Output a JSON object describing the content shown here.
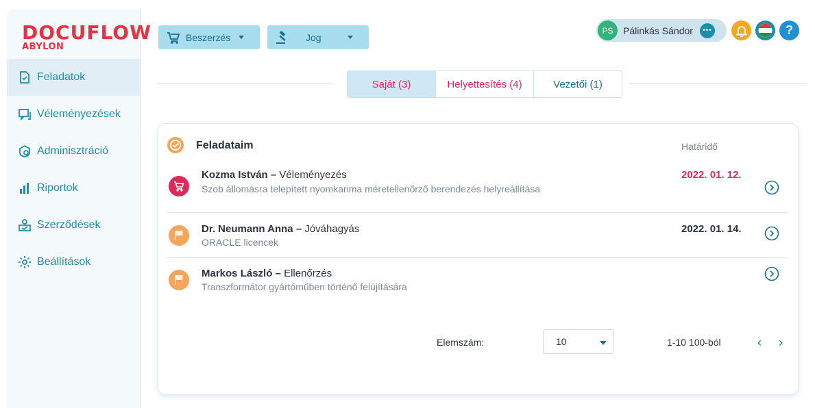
{
  "logo": {
    "main": "DOCUFLOW",
    "sub": "ABYLON"
  },
  "sidebar": {
    "items": [
      {
        "label": "Feladatok",
        "icon": "task-check-icon",
        "active": true
      },
      {
        "label": "Véleményezések",
        "icon": "comments-icon"
      },
      {
        "label": "Adminisztráció",
        "icon": "admin-icon"
      },
      {
        "label": "Riportok",
        "icon": "bar-chart-icon"
      },
      {
        "label": "Szerződések",
        "icon": "contract-icon"
      },
      {
        "label": "Beállítások",
        "icon": "gear-icon"
      }
    ]
  },
  "topbar": {
    "menus": [
      {
        "label": "Beszerzés",
        "icon": "cart-icon"
      },
      {
        "label": "Jog",
        "icon": "gavel-icon"
      }
    ],
    "user": {
      "initials": "PS",
      "name": "Pálinkás Sándor"
    }
  },
  "tabs": [
    {
      "label": "Saját (3)",
      "active": true
    },
    {
      "label": "Helyettesítés (4)"
    },
    {
      "label": "Vezetői (1)"
    }
  ],
  "card": {
    "title": "Feladataim",
    "deadline_header": "Határidő",
    "tasks": [
      {
        "name": "Kozma István",
        "action": "Véleményezés",
        "description": "Szob állomásra telepített nyomkarima méretellenőrző berendezés helyreállítása",
        "deadline": "2022. 01. 12.",
        "icon": "cart-icon",
        "icon_color": "#e0295a",
        "deadline_color": "#e0295a"
      },
      {
        "name": "Dr. Neumann Anna",
        "action": "Jóváhagyás",
        "description": "ORACLE licencek",
        "deadline": "2022. 01. 14.",
        "icon": "flag-icon",
        "icon_color": "#f5a55a",
        "deadline_color": "#2b3440"
      },
      {
        "name": "Markos László",
        "action": "Ellenőrzés",
        "description": "Transzformátor gyártóműben történő felújítására",
        "deadline": "",
        "icon": "flag-icon",
        "icon_color": "#f5a55a",
        "deadline_color": "#2b3440"
      }
    ]
  },
  "pagination": {
    "label": "Elemszám:",
    "page_size": "10",
    "range": "1-10 100-ból",
    "prev": "‹",
    "next": "›"
  },
  "colors": {
    "brand": "#e8323f",
    "accent": "#1b8fa8",
    "alert": "#e0295a",
    "bell": "#f5a623",
    "help": "#1e90d6"
  }
}
